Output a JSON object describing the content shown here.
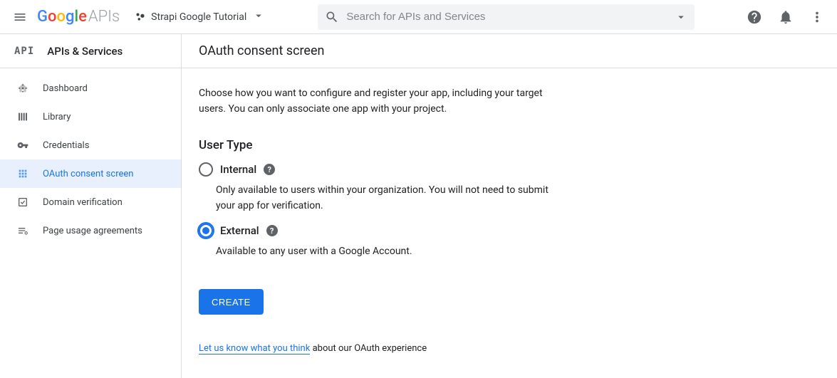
{
  "header": {
    "logo_suffix": "APIs",
    "project_name": "Strapi Google Tutorial",
    "search_placeholder": "Search for APIs and Services"
  },
  "sidebar": {
    "section_badge": "API",
    "section_title": "APIs & Services",
    "items": [
      {
        "label": "Dashboard",
        "icon": "dashboard-icon",
        "active": false
      },
      {
        "label": "Library",
        "icon": "library-icon",
        "active": false
      },
      {
        "label": "Credentials",
        "icon": "credentials-icon",
        "active": false
      },
      {
        "label": "OAuth consent screen",
        "icon": "oauth-icon",
        "active": true
      },
      {
        "label": "Domain verification",
        "icon": "domain-icon",
        "active": false
      },
      {
        "label": "Page usage agreements",
        "icon": "agreements-icon",
        "active": false
      }
    ]
  },
  "content": {
    "page_title": "OAuth consent screen",
    "intro": "Choose how you want to configure and register your app, including your target users. You can only associate one app with your project.",
    "section_title": "User Type",
    "options": [
      {
        "label": "Internal",
        "description": "Only available to users within your organization. You will not need to submit your app for verification.",
        "selected": false
      },
      {
        "label": "External",
        "description": "Available to any user with a Google Account.",
        "selected": true
      }
    ],
    "create_button": "CREATE",
    "feedback_link": "Let us know what you think",
    "feedback_suffix": " about our OAuth experience"
  }
}
